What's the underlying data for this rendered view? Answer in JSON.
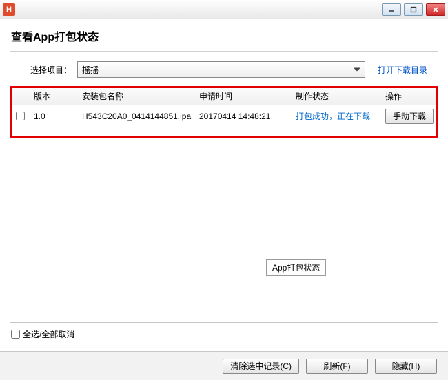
{
  "app_icon_letter": "H",
  "window": {
    "title": "查看App打包状态"
  },
  "selector": {
    "label": "选择项目：",
    "selected": "摇摇"
  },
  "open_download_dir": "打开下载目录",
  "table": {
    "headers": {
      "version": "版本",
      "package_name": "安装包名称",
      "request_time": "申请时间",
      "build_status": "制作状态",
      "action": "操作"
    },
    "rows": [
      {
        "version": "1.0",
        "package_name": "H543C20A0_0414144851.ipa",
        "request_time": "20170414 14:48:21",
        "build_status": "打包成功，正在下载",
        "action_label": "手动下载"
      }
    ]
  },
  "tooltip": "App打包状态",
  "select_all_label": "全选/全部取消",
  "footer": {
    "clear": "清除选中记录(C)",
    "refresh": "刷新(F)",
    "hide": "隐藏(H)"
  }
}
